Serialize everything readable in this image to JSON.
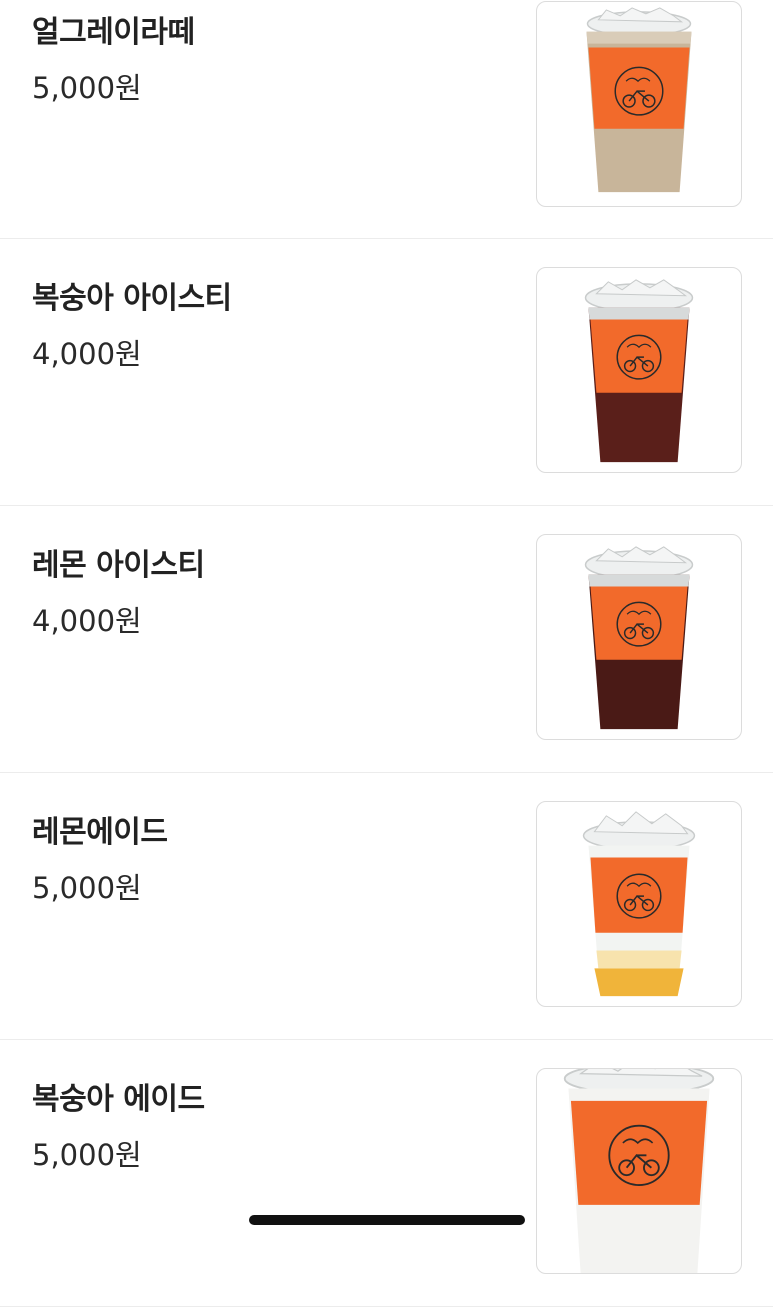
{
  "colors": {
    "sleeve": "#f26a2b",
    "lid": "#e4e6e6",
    "milk_tea": "#c8b59a",
    "tea_dark": "#5a1f1a",
    "lemonade": "#f0b43a"
  },
  "menu": {
    "items": [
      {
        "name": "얼그레이라떼",
        "price": "5,000원",
        "drink": "milk-tea",
        "image_icon": "iced-drink-cup-icon"
      },
      {
        "name": "복숭아 아이스티",
        "price": "4,000원",
        "drink": "dark-tea",
        "image_icon": "iced-drink-cup-icon"
      },
      {
        "name": "레몬 아이스티",
        "price": "4,000원",
        "drink": "dark-tea",
        "image_icon": "iced-drink-cup-icon"
      },
      {
        "name": "레몬에이드",
        "price": "5,000원",
        "drink": "lemonade",
        "image_icon": "iced-drink-cup-icon"
      },
      {
        "name": "복숭아 에이드",
        "price": "5,000원",
        "drink": "ade",
        "image_icon": "iced-drink-cup-icon"
      }
    ]
  }
}
